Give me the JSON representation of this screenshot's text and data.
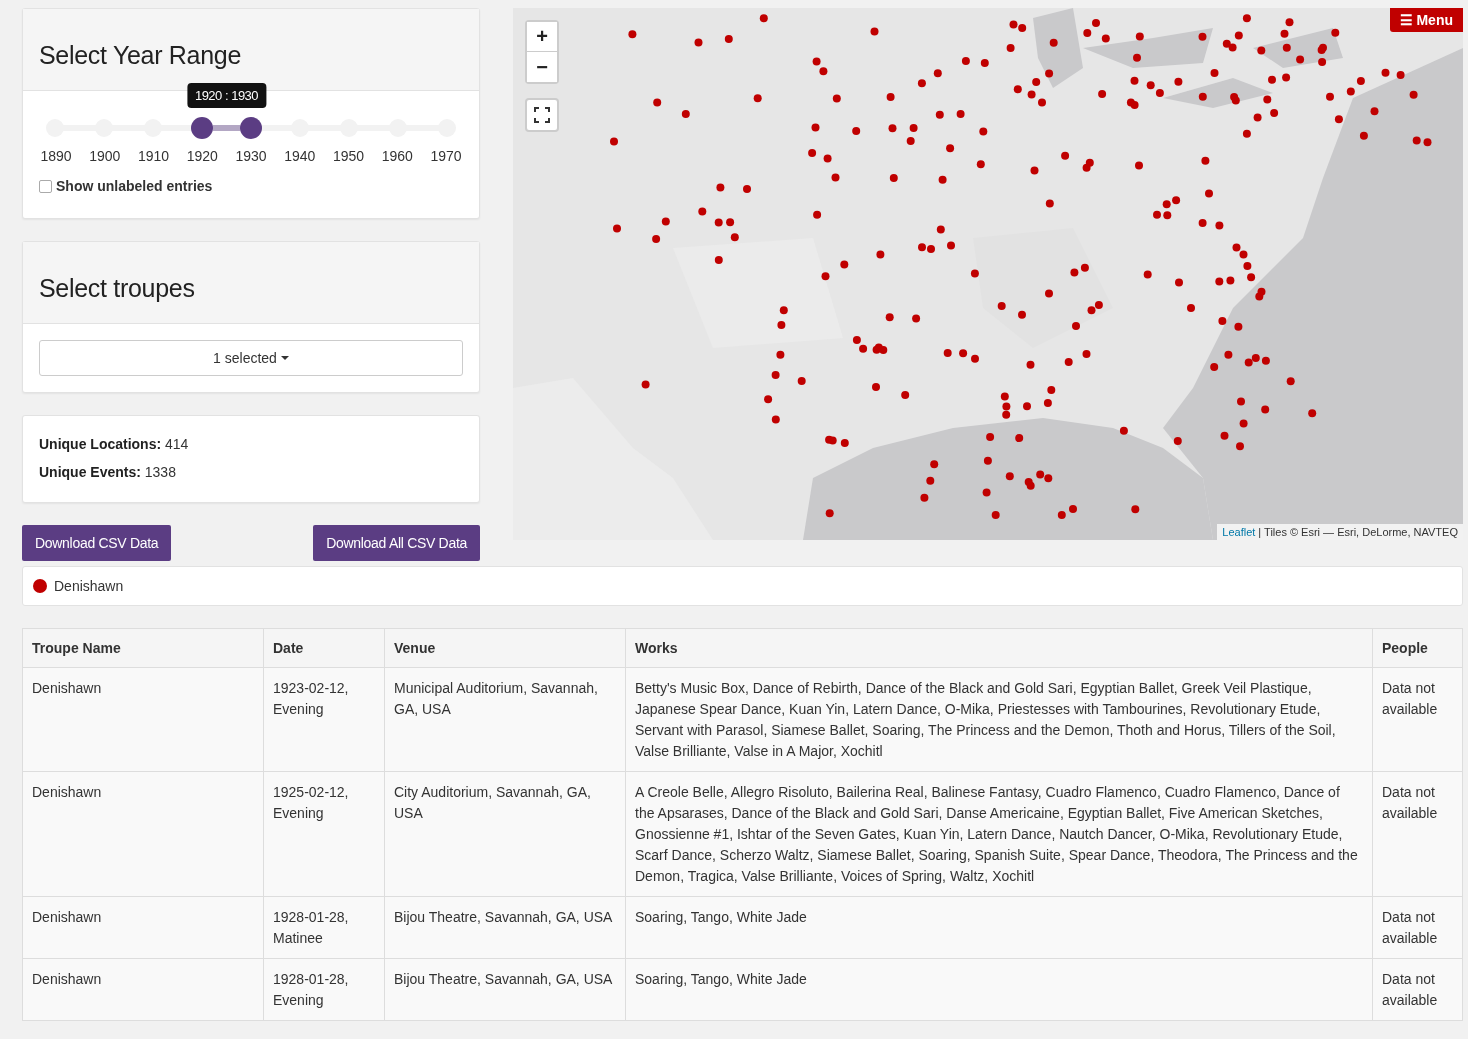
{
  "year_range": {
    "title": "Select Year Range",
    "tooltip": "1920 : 1930",
    "ticks": [
      "1890",
      "1900",
      "1910",
      "1920",
      "1930",
      "1940",
      "1950",
      "1960",
      "1970"
    ],
    "handles": [
      {
        "level": 0.375
      },
      {
        "level": 0.5
      }
    ],
    "unlabeled": {
      "label": "Show unlabeled entries",
      "checked": false
    }
  },
  "troupes": {
    "title": "Select troupes",
    "dropdown": "1 selected"
  },
  "stats": [
    "**Unique Locations:** 414",
    "**Unique Events:** 1338"
  ],
  "buttons": [
    "Download CSV Data",
    "Download All CSV Data"
  ],
  "map": {
    "kind": "picture",
    "zoom_in": "+",
    "zoom_out": "−",
    "menu": {
      "icon": "☰",
      "label": "Menu"
    },
    "attribution_link": "Leaflet",
    "attribution": "| Tiles © Esri — Esri, DeLorme, NAVTEQ"
  },
  "legend": [
    {
      "label": "Denishawn",
      "color": "#c00000"
    }
  ],
  "table": {
    "columns": [
      "Troupe Name",
      "Date",
      "Venue",
      "Works",
      "People"
    ],
    "rows": [
      [
        "Denishawn",
        "1923-02-12, Evening",
        "Municipal Auditorium, Savannah, GA, USA",
        "Betty's Music Box, Dance of Rebirth, Dance of the Black and Gold Sari, Egyptian Ballet, Greek Veil Plastique, Japanese Spear Dance, Kuan Yin, Latern Dance, O-Mika, Priestesses with Tambourines, Revolutionary Etude, Servant with Parasol, Siamese Ballet, Soaring, The Princess and the Demon, Thoth and Horus, Tillers of the Soil, Valse Brilliante, Valse in A Major, Xochitl",
        "Data not available"
      ],
      [
        "Denishawn",
        "1925-02-12, Evening",
        "City Auditorium, Savannah, GA, USA",
        "A Creole Belle, Allegro Risoluto, Bailerina Real, Balinese Fantasy, Cuadro Flamenco, Cuadro Flamenco, Dance of the Apsarases, Dance of the Black and Gold Sari, Danse Americaine, Egyptian Ballet, Five American Sketches, Gnossienne #1, Ishtar of the Seven Gates, Kuan Yin, Latern Dance, Nautch Dancer, O-Mika, Revolutionary Etude, Scarf Dance, Scherzo Waltz, Siamese Ballet, Soaring, Spanish Suite, Spear Dance, Theodora, The Princess and the Demon, Tragica, Valse Brilliante, Voices of Spring, Waltz, Xochitl",
        "Data not available"
      ],
      [
        "Denishawn",
        "1928-01-28, Matinee",
        "Bijou Theatre, Savannah, GA, USA",
        "Soaring, Tango, White Jade",
        "Data not available"
      ],
      [
        "Denishawn",
        "1928-01-28, Evening",
        "Bijou Theatre, Savannah, GA, USA",
        "Soaring, Tango, White Jade",
        "Data not available"
      ]
    ]
  }
}
